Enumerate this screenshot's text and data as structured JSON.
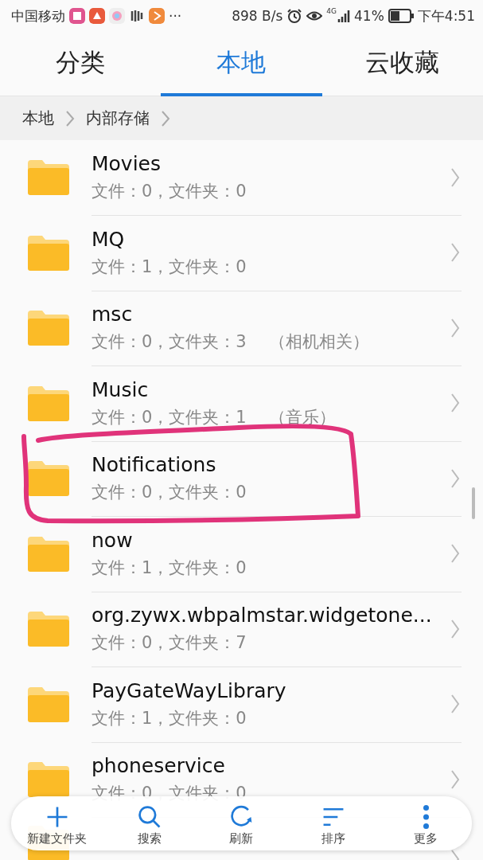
{
  "status_bar": {
    "carrier": "中国移动",
    "more": "···",
    "speed": "898 B/s",
    "network": "4G",
    "battery": "41%",
    "time": "下午4:51"
  },
  "tabs": [
    {
      "label": "分类",
      "selected": false
    },
    {
      "label": "本地",
      "selected": true
    },
    {
      "label": "云收藏",
      "selected": false
    }
  ],
  "breadcrumb": [
    "本地",
    "内部存储"
  ],
  "folders": [
    {
      "name": "Movies",
      "info": "文件：0，文件夹：0"
    },
    {
      "name": "MQ",
      "info": "文件：1，文件夹：0"
    },
    {
      "name": "msc",
      "info": "文件：0，文件夹：3",
      "note": "（相机相关）"
    },
    {
      "name": "Music",
      "info": "文件：0，文件夹：1",
      "note": "（音乐）"
    },
    {
      "name": "Notifications",
      "info": "文件：0，文件夹：0"
    },
    {
      "name": "now",
      "info": "文件：1，文件夹：0"
    },
    {
      "name": "org.zywx.wbpalmstar.widgetone...",
      "info": "文件：0，文件夹：7"
    },
    {
      "name": "PayGateWayLibrary",
      "info": "文件：1，文件夹：0"
    },
    {
      "name": "phoneservice",
      "info": "文件：0，文件夹：0"
    },
    {
      "kind": "hidden"
    }
  ],
  "toolbar": [
    {
      "kind": "add",
      "label": "新建文件夹"
    },
    {
      "kind": "search",
      "label": "搜索"
    },
    {
      "kind": "refresh",
      "label": "刷新"
    },
    {
      "kind": "sort",
      "label": "排序"
    },
    {
      "kind": "more",
      "label": "更多"
    }
  ]
}
